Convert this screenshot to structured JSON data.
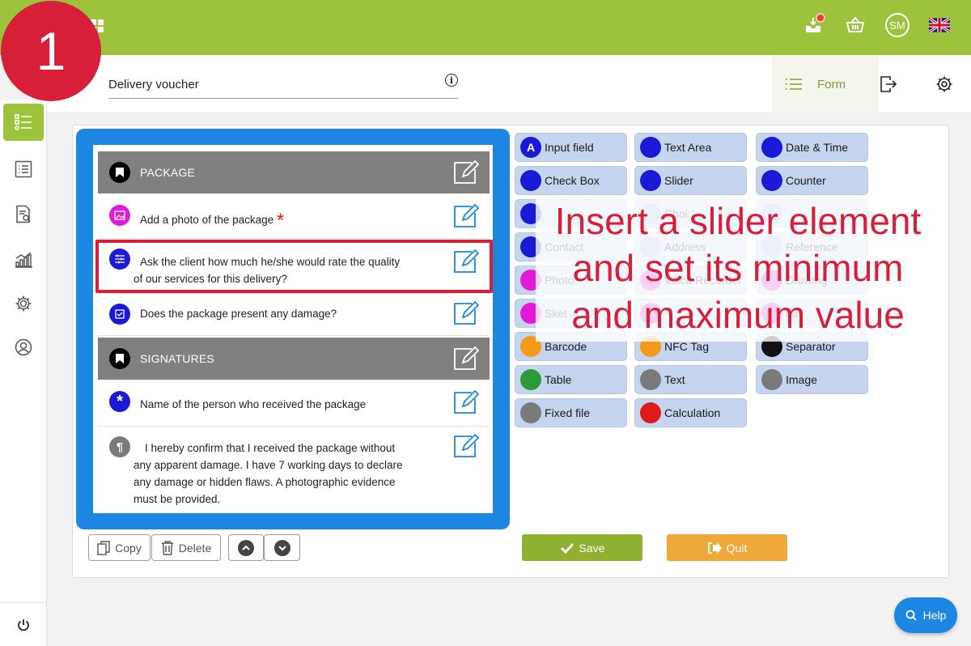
{
  "step": "1",
  "header": {
    "form_title": "Delivery voucher",
    "form_tab_label": "Form"
  },
  "topbar": {
    "avatar_initials": "SM"
  },
  "form": {
    "sections": [
      {
        "label": "PACKAGE"
      },
      {
        "label": "SIGNATURES"
      }
    ],
    "fields": [
      {
        "label": "Add a photo of the package",
        "required_mark": "*"
      },
      {
        "label_line1": "Ask the client how much he/she would rate the quality",
        "label_line2": "of our services for this delivery?"
      },
      {
        "label": "Does the package present any damage?"
      },
      {
        "label": "Name of the person who received the package"
      },
      {
        "line1": "I hereby confirm that I received the package without",
        "line2": "any apparent damage. I have 7 working days to declare",
        "line3": "any damage or hidden flaws. A photographic evidence",
        "line4": "must be provided."
      }
    ]
  },
  "palette": [
    {
      "label": "Input field",
      "icon": "A",
      "color": "#1a1ad6"
    },
    {
      "label": "Text Area",
      "color": "#1a1ad6"
    },
    {
      "label": "Date & Time",
      "color": "#1a1ad6"
    },
    {
      "label": "Check Box",
      "color": "#1a1ad6"
    },
    {
      "label": "Slider",
      "color": "#1a1ad6"
    },
    {
      "label": "Counter",
      "color": "#1a1ad6"
    },
    {
      "label": "",
      "color": "#1a1ad6"
    },
    {
      "label": "Choi",
      "color": "#9bb6e8"
    },
    {
      "label": "",
      "color": "#9bb6e8"
    },
    {
      "label": "Contact",
      "color": "#1a1ad6"
    },
    {
      "label": "Address",
      "color": "#9bb6e8"
    },
    {
      "label": "Reference",
      "color": "#9bb6e8"
    },
    {
      "label": "Photo",
      "color": "#e01ad6"
    },
    {
      "label": "Voice Recorder",
      "color": "#e01ad6"
    },
    {
      "label": "Drawing",
      "color": "#e01ad6"
    },
    {
      "label": "Sket",
      "color": "#e01ad6"
    },
    {
      "label": "",
      "color": "#e01ad6"
    },
    {
      "label": "nat",
      "color": "#e01ad6"
    },
    {
      "label": "Barcode",
      "color": "#f39a1a"
    },
    {
      "label": "NFC Tag",
      "color": "#f39a1a"
    },
    {
      "label": "Separator",
      "color": "#111111"
    },
    {
      "label": "Table",
      "color": "#2c9a37"
    },
    {
      "label": "Text",
      "color": "#7a7a7a"
    },
    {
      "label": "Image",
      "color": "#7a7a7a"
    },
    {
      "label": "Fixed file",
      "color": "#7a7a7a"
    },
    {
      "label": "Calculation",
      "color": "#e01a1a"
    }
  ],
  "overlay": {
    "line1": "Insert a slider element",
    "line2": "and set its minimum",
    "line3": "and maximum value"
  },
  "toolbar": {
    "copy_label": "Copy",
    "delete_label": "Delete",
    "save_label": "Save",
    "quit_label": "Quit"
  },
  "help_label": "Help",
  "colors": {
    "brand_green": "#9dc23c",
    "form_blue": "#1d86e3",
    "accent_red": "#d71f3a",
    "quit_orange": "#efa93a"
  }
}
